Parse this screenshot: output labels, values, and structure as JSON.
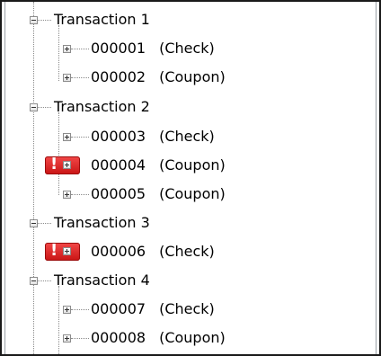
{
  "transactions": [
    {
      "label": "Transaction 1",
      "items": [
        {
          "id": "000001",
          "type": "(Check)",
          "alert": false
        },
        {
          "id": "000002",
          "type": "(Coupon)",
          "alert": false
        }
      ]
    },
    {
      "label": "Transaction 2",
      "items": [
        {
          "id": "000003",
          "type": "(Check)",
          "alert": false
        },
        {
          "id": "000004",
          "type": "(Coupon)",
          "alert": true
        },
        {
          "id": "000005",
          "type": "(Coupon)",
          "alert": false
        }
      ]
    },
    {
      "label": "Transaction 3",
      "items": [
        {
          "id": "000006",
          "type": "(Check)",
          "alert": true
        }
      ]
    },
    {
      "label": "Transaction 4",
      "items": [
        {
          "id": "000007",
          "type": "(Check)",
          "alert": false
        },
        {
          "id": "000008",
          "type": "(Coupon)",
          "alert": false
        }
      ]
    }
  ],
  "colors": {
    "alert": "#dd2b2b",
    "tree_lines": "#8a8a8a",
    "border": "#1a1a1a"
  },
  "icons": {
    "collapse": "minus-box-icon",
    "expand": "plus-box-icon",
    "alert": "exclamation-alert-icon"
  }
}
